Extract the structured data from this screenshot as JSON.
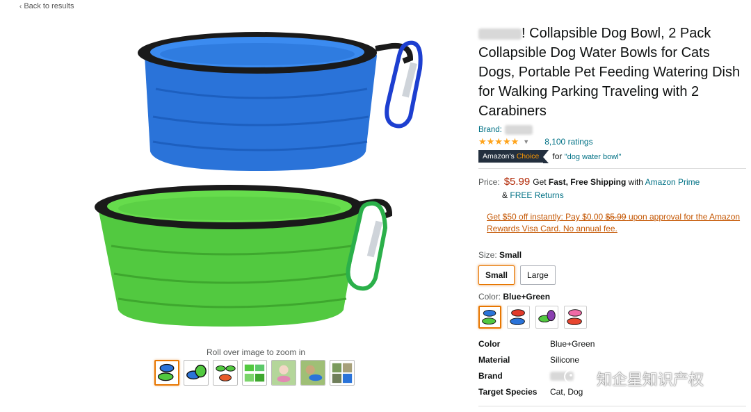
{
  "nav": {
    "back_label": "Back to results"
  },
  "gallery": {
    "roll_text": "Roll over image to zoom in",
    "thumb_count": 7
  },
  "product": {
    "title": "Collapsible Dog Bowl, 2 Pack Collapsible Dog Water Bowls for Cats Dogs, Portable Pet Feeding Watering Dish for Walking Parking Traveling with 2 Carabiners",
    "title_prefix_mark": "!",
    "brand_label": "Brand:",
    "rating_stars": "★★★★★",
    "rating_value": 4.5,
    "ratings_count": "8,100 ratings",
    "badge_main": "Amazon's",
    "badge_accent": "Choice",
    "badge_for": "for",
    "badge_keyword": "\"dog water bowl\""
  },
  "pricing": {
    "label": "Price:",
    "price": "$5.99",
    "shipping_pre": "Get",
    "shipping_bold": "Fast, Free Shipping",
    "shipping_with": "with",
    "prime_text": "Amazon Prime",
    "returns_amp": "&",
    "returns_text": "FREE Returns",
    "offer_part1": "Get $50 off instantly: Pay $0.00",
    "offer_strike": "$5.99",
    "offer_part2": "upon approval for the Amazon Rewards Visa Card. No annual fee."
  },
  "size": {
    "label": "Size:",
    "selected": "Small",
    "options": [
      "Small",
      "Large"
    ]
  },
  "color": {
    "label": "Color:",
    "selected": "Blue+Green",
    "swatch_count": 4,
    "accent": "#e77600"
  },
  "specs": [
    {
      "key": "Color",
      "value": "Blue+Green"
    },
    {
      "key": "Material",
      "value": "Silicone"
    },
    {
      "key": "Brand",
      "value": ""
    },
    {
      "key": "Target Species",
      "value": "Cat, Dog"
    }
  ],
  "watermark": {
    "text": "知企星知识产权"
  },
  "colors": {
    "link": "#007185",
    "price": "#b12704",
    "offer": "#c45500",
    "star": "#ffa41c",
    "badge_bg": "#232f3e"
  }
}
